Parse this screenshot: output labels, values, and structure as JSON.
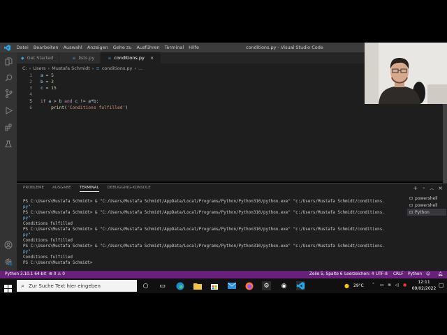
{
  "titlebar": {
    "menu": [
      "Datei",
      "Bearbeiten",
      "Auswahl",
      "Anzeigen",
      "Gehe zu",
      "Ausführen",
      "Terminal",
      "Hilfe"
    ],
    "title": "conditions.py - Visual Studio Code"
  },
  "tabs": [
    {
      "label": "Get Started",
      "icon": "vscode-icon",
      "active": false
    },
    {
      "label": "lists.py",
      "icon": "python-file-icon",
      "active": false
    },
    {
      "label": "conditions.py",
      "icon": "python-file-icon",
      "active": true
    }
  ],
  "breadcrumb": [
    "C:",
    "Users",
    "Mustafa Schmidt",
    "conditions.py",
    "..."
  ],
  "editor": {
    "lines": [
      {
        "num": "1",
        "text": "a = 5"
      },
      {
        "num": "2",
        "text": "b = 3"
      },
      {
        "num": "3",
        "text": "c = 15"
      },
      {
        "num": "4",
        "text": ""
      },
      {
        "num": "5",
        "text": "if a > b and c != a*b:"
      },
      {
        "num": "6",
        "text": "    print('Conditions fulfilled')"
      }
    ]
  },
  "panel": {
    "tabs": [
      "PROBLEME",
      "AUSGABE",
      "TERMINAL",
      "DEBUGGING-KONSOLE"
    ],
    "active_tab": "TERMINAL",
    "terminal_lines": [
      "PS C:\\Users\\Mustafa Schmidt> & \"C:/Users/Mustafa Schmidt/AppData/Local/Programs/Python/Python310/python.exe\" \"c:/Users/Mustafa Schmidt/conditions.",
      "py\"",
      "PS C:\\Users\\Mustafa Schmidt> & \"C:/Users/Mustafa Schmidt/AppData/Local/Programs/Python/Python310/python.exe\" \"c:/Users/Mustafa Schmidt/conditions.",
      "py\"",
      "Conditions fulfilled",
      "PS C:\\Users\\Mustafa Schmidt> & \"C:/Users/Mustafa Schmidt/AppData/Local/Programs/Python/Python310/python.exe\" \"c:/Users/Mustafa Schmidt/conditions.",
      "py\"",
      "Conditions fulfilled",
      "PS C:\\Users\\Mustafa Schmidt> & \"C:/Users/Mustafa Schmidt/AppData/Local/Programs/Python/Python310/python.exe\" \"c:/Users/Mustafa Schmidt/conditions.",
      "py\"",
      "Conditions fulfilled",
      "PS C:\\Users\\Mustafa Schmidt> "
    ],
    "terminals": [
      {
        "label": "powershell",
        "selected": false
      },
      {
        "label": "powershell",
        "selected": false
      },
      {
        "label": "Python",
        "selected": true
      }
    ]
  },
  "statusbar": {
    "python_version": "Python 3.10.1 64-bit",
    "errors": "0",
    "warnings": "0",
    "position": "Zeile 5, Spalte 6",
    "spaces": "Leerzeichen: 4",
    "encoding": "UTF-8",
    "eol": "CRLF",
    "language": "Python"
  },
  "taskbar": {
    "search_placeholder": "Zur Suche Text hier eingeben",
    "weather": "29°C",
    "time": "12:11",
    "date": "09/02/2022"
  },
  "colors": {
    "statusbar": "#68217a",
    "titlebar": "#3c3c3c",
    "editor_bg": "#1e1e1e",
    "activity_bar": "#333333"
  }
}
